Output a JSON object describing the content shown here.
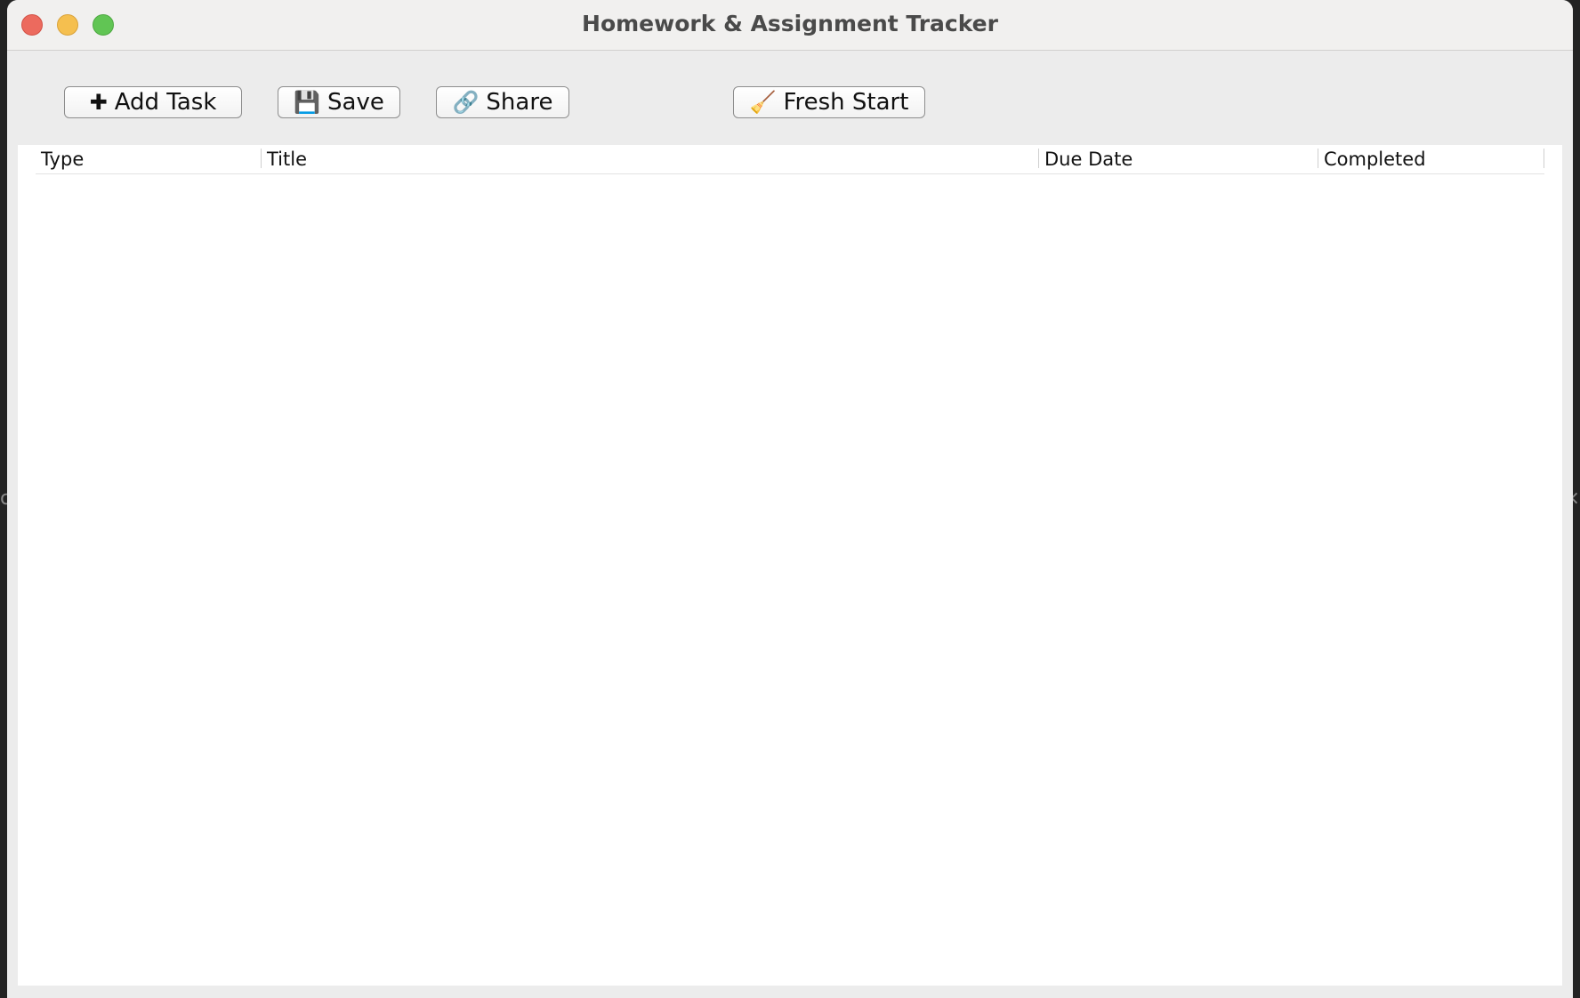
{
  "window": {
    "title": "Homework & Assignment Tracker"
  },
  "toolbar": {
    "buttons": [
      {
        "id": "add",
        "icon": "plus-icon",
        "glyph": "✚",
        "label": "Add Task"
      },
      {
        "id": "save",
        "icon": "floppy-disk-icon",
        "glyph": "💾",
        "label": "Save"
      },
      {
        "id": "share",
        "icon": "link-icon",
        "glyph": "🔗",
        "label": "Share"
      },
      {
        "id": "fresh",
        "icon": "broom-icon",
        "glyph": "🧹",
        "label": "Fresh Start"
      }
    ]
  },
  "table": {
    "columns": [
      "Type",
      "Title",
      "Due Date",
      "Completed"
    ],
    "rows": []
  },
  "colors": {
    "close": "#ec6a5e",
    "minimize": "#f5bf4f",
    "maximize": "#61c554",
    "window_bg": "#ececec",
    "table_bg": "#ffffff"
  }
}
